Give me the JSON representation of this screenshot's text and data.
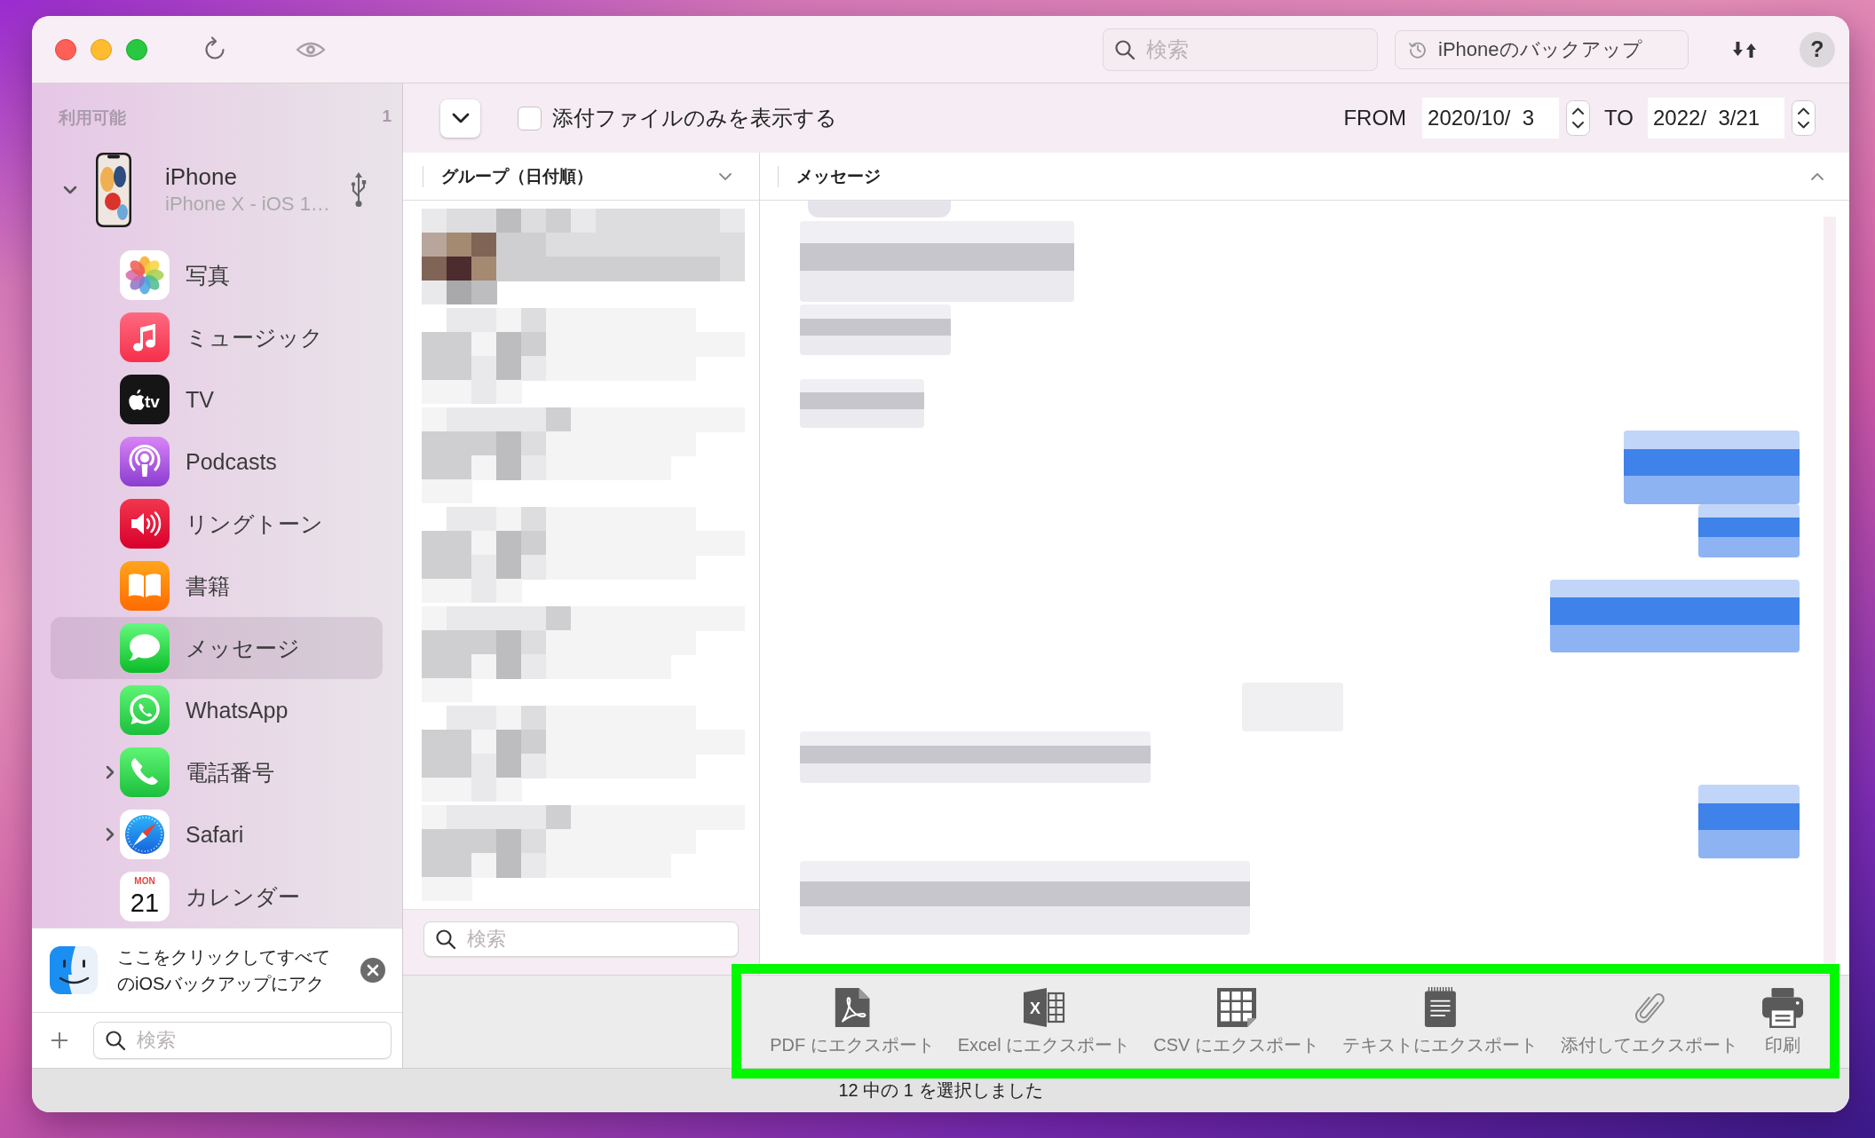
{
  "title_bar": {
    "search": {
      "placeholder": "検索"
    },
    "backup_button": {
      "label": "iPhoneのバックアップ"
    },
    "help_button": {
      "label": "?"
    }
  },
  "sidebar": {
    "section_title": "利用可能",
    "count": "1",
    "device": {
      "name": "iPhone",
      "subtitle": "iPhone X - iOS 1…",
      "expanded": true
    },
    "items": [
      {
        "label": "写真",
        "kind": "photos",
        "selected": false,
        "expandable": false
      },
      {
        "label": "ミュージック",
        "kind": "music",
        "selected": false,
        "expandable": false
      },
      {
        "label": "TV",
        "kind": "tv",
        "selected": false,
        "expandable": false,
        "icon_text": "tv"
      },
      {
        "label": "Podcasts",
        "kind": "podcasts",
        "selected": false,
        "expandable": false
      },
      {
        "label": "リングトーン",
        "kind": "ringtones",
        "selected": false,
        "expandable": false
      },
      {
        "label": "書籍",
        "kind": "books",
        "selected": false,
        "expandable": false
      },
      {
        "label": "メッセージ",
        "kind": "messages",
        "selected": true,
        "expandable": false
      },
      {
        "label": "WhatsApp",
        "kind": "whatsapp",
        "selected": false,
        "expandable": false
      },
      {
        "label": "電話番号",
        "kind": "phone",
        "selected": false,
        "expandable": true
      },
      {
        "label": "Safari",
        "kind": "safari",
        "selected": false,
        "expandable": true
      },
      {
        "label": "カレンダー",
        "kind": "calendar",
        "selected": false,
        "expandable": false,
        "icon_caption": "MON",
        "icon_text": "21"
      }
    ],
    "banner": {
      "lines": [
        "ここをクリックしてすべて",
        "のiOSバックアップにアク"
      ]
    },
    "search": {
      "placeholder": "検索"
    }
  },
  "toolbar": {
    "attachments_only": {
      "label": "添付ファイルのみを表示する",
      "checked": false
    },
    "from": {
      "label": "FROM",
      "value": "2020/10/  3"
    },
    "to": {
      "label": "TO",
      "value": "2022/  3/21"
    }
  },
  "columns": [
    {
      "title": "グループ（日付順）"
    },
    {
      "title": "メッセージ"
    }
  ],
  "group_search": {
    "placeholder": "検索"
  },
  "export_toolbar": {
    "highlighted": true,
    "actions": [
      {
        "label": "PDF にエクスポート",
        "kind": "pdf"
      },
      {
        "label": "Excel にエクスポート",
        "kind": "excel",
        "icon_text": "X"
      },
      {
        "label": "CSV にエクスポート",
        "kind": "csv"
      },
      {
        "label": "テキストにエクスポート",
        "kind": "text"
      },
      {
        "label": "添付してエクスポート",
        "kind": "attach"
      },
      {
        "label": "印刷",
        "kind": "print"
      }
    ]
  },
  "status_bar": {
    "text": "12 中の 1 を選択しました"
  }
}
